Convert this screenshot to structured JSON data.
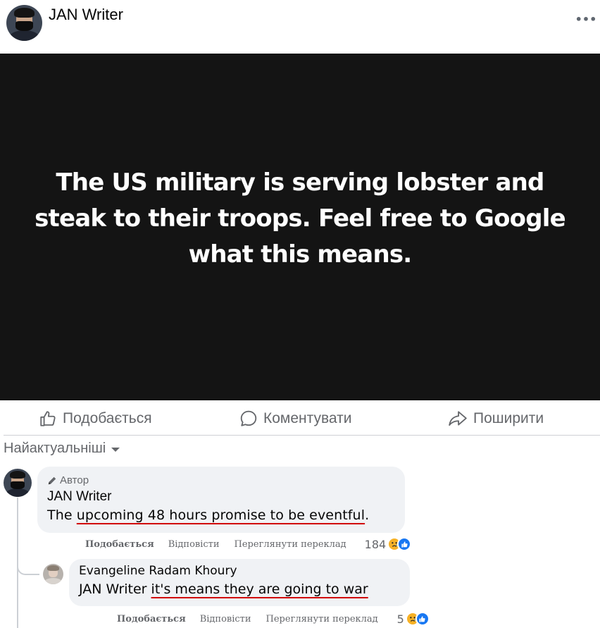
{
  "header": {
    "author_name": "JAN Writer",
    "more_label": "•••"
  },
  "post": {
    "image_text": "The US military is serving lobster and steak to their troops. Feel free to Google what this means."
  },
  "actions": {
    "like_label": "Подобається",
    "comment_label": "Коментувати",
    "share_label": "Поширити"
  },
  "sort": {
    "label": "Найактуальніші"
  },
  "comments": [
    {
      "badge": "Автор",
      "name": "JAN Writer",
      "text_before": "The ",
      "text_underlined": "upcoming 48 hours promise to be eventful",
      "text_after": ".",
      "like_label": "Подобається",
      "reply_label": "Відповісти",
      "translate_label": "Переглянути переклад",
      "reaction_count": "184"
    },
    {
      "name": "Evangeline Radam Khoury",
      "mention": "JAN Writer",
      "text_before": " ",
      "text_underlined": "it's means they are going to war",
      "like_label": "Подобається",
      "reply_label": "Відповісти",
      "translate_label": "Переглянути переклад",
      "reaction_count": "5"
    }
  ],
  "colors": {
    "post_bg": "#141414",
    "bubble_bg": "#f0f2f5",
    "secondary_text": "#65676b",
    "underline": "#d10000",
    "like_blue": "#1877f2",
    "sad_yellow": "#f7b125"
  },
  "icons": [
    "thumbs-up-icon",
    "speech-bubble-icon",
    "share-arrow-icon",
    "caret-down-icon",
    "pencil-icon",
    "sad-reaction-icon",
    "like-reaction-icon"
  ]
}
